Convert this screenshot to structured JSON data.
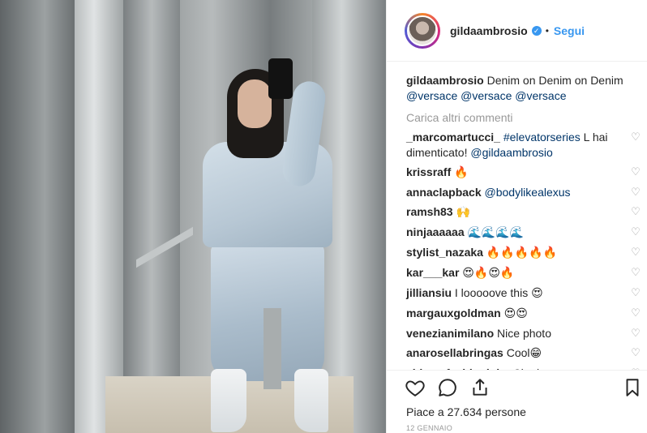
{
  "post": {
    "username": "gildaambrosio",
    "follow_label": "Segui",
    "separator": "•",
    "caption_user": "gildaambrosio",
    "caption_text": "Denim on Denim on Denim",
    "caption_mentions": "@versace @versace @versace",
    "load_more": "Carica altri commenti",
    "likes": "Piace a 27.634 persone",
    "date": "12 GENNAIO"
  },
  "comments": [
    {
      "user": "_marcomartucci_",
      "parts": [
        {
          "t": "#elevatorseries",
          "link": true
        },
        {
          "t": " L hai dimenticato! "
        },
        {
          "t": "@gildaambrosio",
          "link": true
        }
      ]
    },
    {
      "user": "krissraff",
      "parts": [
        {
          "t": "🔥",
          "emoji": true
        }
      ]
    },
    {
      "user": "annaclapback",
      "parts": [
        {
          "t": "@bodylikealexus",
          "link": true
        }
      ]
    },
    {
      "user": "ramsh83",
      "parts": [
        {
          "t": "🙌",
          "emoji": true
        }
      ]
    },
    {
      "user": "ninjaaaaaa",
      "parts": [
        {
          "t": "🌊🌊🌊🌊",
          "emoji": true
        }
      ]
    },
    {
      "user": "stylist_nazaka",
      "parts": [
        {
          "t": "🔥🔥🔥🔥🔥",
          "emoji": true
        }
      ]
    },
    {
      "user": "kar___kar",
      "parts": [
        {
          "t": "😍🔥😍🔥",
          "emoji": true
        }
      ]
    },
    {
      "user": "jilliansiu",
      "parts": [
        {
          "t": "I looooove this "
        },
        {
          "t": "😍",
          "emoji": true
        }
      ]
    },
    {
      "user": "margauxgoldman",
      "parts": [
        {
          "t": "😍😍",
          "emoji": true
        }
      ]
    },
    {
      "user": "venezianimilano",
      "parts": [
        {
          "t": "Nice photo"
        }
      ]
    },
    {
      "user": "anarosellabringas",
      "parts": [
        {
          "t": "Cool"
        },
        {
          "t": "😁",
          "emoji": true
        }
      ]
    },
    {
      "user": "chiara_fashionjobs",
      "parts": [
        {
          "t": "Che brava"
        }
      ]
    }
  ],
  "icons": {
    "like": "heart-outline-icon",
    "comment": "speech-bubble-icon",
    "share": "share-arrow-icon",
    "save": "bookmark-icon",
    "verified": "verified-badge-icon",
    "comment_like": "small-heart-icon"
  },
  "colors": {
    "link": "#003569",
    "follow": "#3897f0",
    "muted": "#999999",
    "text": "#262626"
  }
}
